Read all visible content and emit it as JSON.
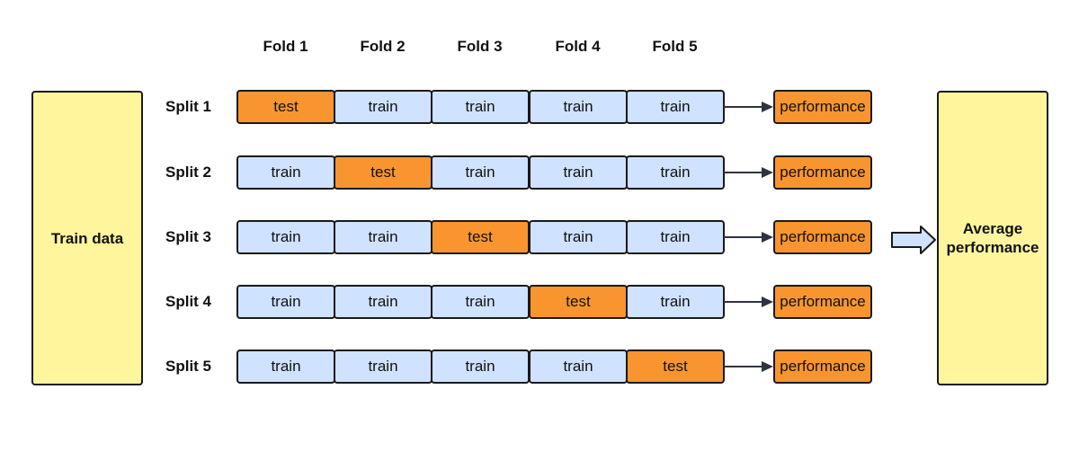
{
  "left_box": {
    "label": "Train data"
  },
  "right_box": {
    "label_line1": "Average",
    "label_line2": "performance"
  },
  "folds": [
    "Fold 1",
    "Fold 2",
    "Fold 3",
    "Fold 4",
    "Fold 5"
  ],
  "splits": [
    {
      "label": "Split 1",
      "cells": [
        "test",
        "train",
        "train",
        "train",
        "train"
      ],
      "result": "performance"
    },
    {
      "label": "Split 2",
      "cells": [
        "train",
        "test",
        "train",
        "train",
        "train"
      ],
      "result": "performance"
    },
    {
      "label": "Split 3",
      "cells": [
        "train",
        "train",
        "test",
        "train",
        "train"
      ],
      "result": "performance"
    },
    {
      "label": "Split 4",
      "cells": [
        "train",
        "train",
        "train",
        "test",
        "train"
      ],
      "result": "performance"
    },
    {
      "label": "Split 5",
      "cells": [
        "train",
        "train",
        "train",
        "train",
        "test"
      ],
      "result": "performance"
    }
  ],
  "colors": {
    "train": "#cfe2ff",
    "test": "#f8952f",
    "performance": "#f8952f",
    "data_box": "#fff59d"
  }
}
